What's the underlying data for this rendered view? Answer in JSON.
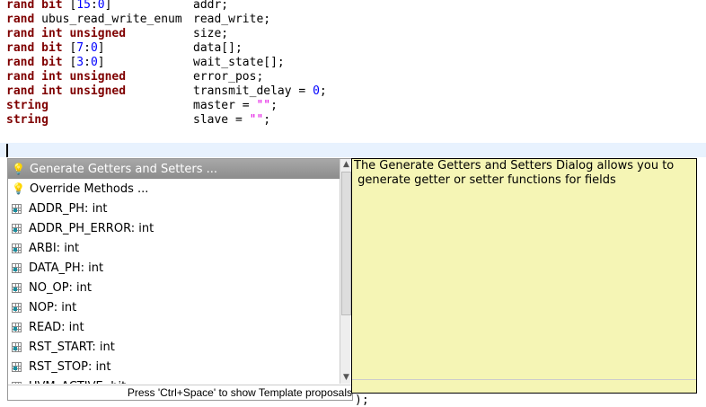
{
  "code": [
    {
      "type": "rand bit ",
      "range": [
        "[",
        "15",
        ":",
        "0",
        "]"
      ],
      "name": "addr;"
    },
    {
      "type": "rand ",
      "plain": "ubus_read_write_enum",
      "name": "read_write;"
    },
    {
      "type": "rand int unsigned",
      "name": "size;"
    },
    {
      "type": "rand bit ",
      "range": [
        "[",
        "7",
        ":",
        "0",
        "]"
      ],
      "name": "data[];"
    },
    {
      "type": "rand bit ",
      "range": [
        "[",
        "3",
        ":",
        "0",
        "]"
      ],
      "name": "wait_state[];"
    },
    {
      "type": "rand int unsigned",
      "name": "error_pos;"
    },
    {
      "type": "rand int unsigned",
      "name": "transmit_delay = ",
      "num": "0",
      "end": ";"
    },
    {
      "type": "string",
      "name": "master = ",
      "str": "\"\"",
      "end": ";"
    },
    {
      "type": "string",
      "name": "slave = ",
      "str": "\"\"",
      "end": ";"
    }
  ],
  "proposals": [
    {
      "label": "Generate Getters and Setters ...",
      "icon": "lightbulb",
      "selected": true
    },
    {
      "label": "Override Methods ...",
      "icon": "lightbulb"
    },
    {
      "label": "ADDR_PH: int",
      "icon": "field"
    },
    {
      "label": "ADDR_PH_ERROR: int",
      "icon": "field"
    },
    {
      "label": "ARBI: int",
      "icon": "field"
    },
    {
      "label": "DATA_PH: int",
      "icon": "field"
    },
    {
      "label": "NO_OP: int",
      "icon": "field"
    },
    {
      "label": "NOP: int",
      "icon": "field"
    },
    {
      "label": "READ: int",
      "icon": "field"
    },
    {
      "label": "RST_START: int",
      "icon": "field"
    },
    {
      "label": "RST_STOP: int",
      "icon": "field"
    },
    {
      "label": "UVM_ACTIVE: bit",
      "icon": "field"
    }
  ],
  "status": "Press 'Ctrl+Space' to show Template proposals",
  "tooltip": "The Generate Getters and Setters Dialog allows you to\n generate getter or setter functions for fields",
  "below_text": ");"
}
